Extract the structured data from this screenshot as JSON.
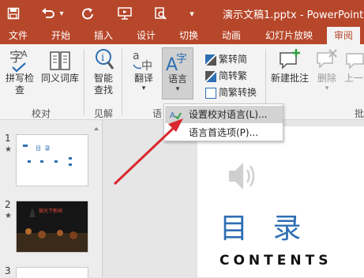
{
  "titlebar": {
    "title": "演示文稿1.pptx - PowerPoint",
    "quick_access": [
      {
        "name": "save-icon",
        "glyph": "🖫"
      },
      {
        "name": "undo-icon",
        "glyph": "↶"
      },
      {
        "name": "undo-dropdown-icon",
        "glyph": "▾"
      },
      {
        "name": "redo-icon",
        "glyph": "↻"
      },
      {
        "name": "present-icon",
        "glyph": "▣"
      },
      {
        "name": "preview-icon",
        "glyph": "⌕"
      },
      {
        "name": "customize-icon",
        "glyph": "▾"
      }
    ]
  },
  "tabs": [
    "文件",
    "开始",
    "插入",
    "设计",
    "切换",
    "动画",
    "幻灯片放映",
    "审阅"
  ],
  "active_tab": "审阅",
  "ribbon": {
    "spelling": "拼写检查",
    "thesaurus": "同义词库",
    "smart_lookup_1": "智能",
    "smart_lookup_2": "查找",
    "translate": "翻译",
    "language": "语言",
    "trad_to_simp": "繁转简",
    "simp_to_trad": "简转繁",
    "convert": "简繁转换",
    "new_comment": "新建批注",
    "delete": "删除",
    "previous": "上一",
    "groups": {
      "proofing": "校对",
      "insights": "见解",
      "language": "语",
      "comments": "批"
    }
  },
  "menu": {
    "set_proofing": "设置校对语言(L)...",
    "language_prefs": "语言首选项(P)..."
  },
  "thumbnails": [
    {
      "num": "1",
      "star": "★",
      "title": "目  录"
    },
    {
      "num": "2",
      "star": "★",
      "title": "银光下新闻"
    },
    {
      "num": "3"
    }
  ],
  "slide": {
    "title": "目 录",
    "subtitle": "CONTENTS"
  },
  "colors": {
    "accent": "#b7472a",
    "slide_title": "#2f6fb3",
    "arrow": "#d9282f"
  }
}
